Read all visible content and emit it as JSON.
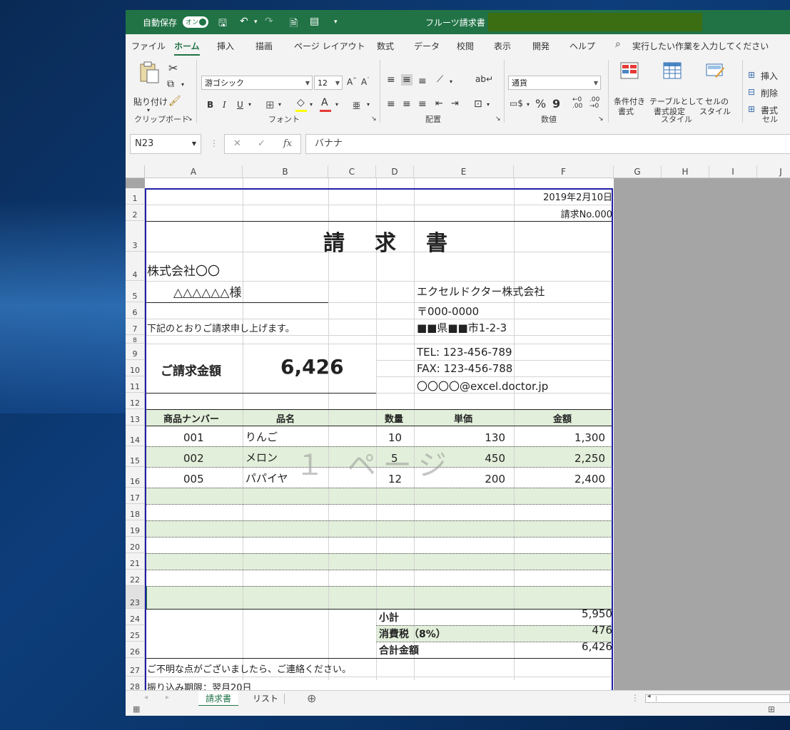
{
  "titlebar": {
    "autosave_label": "自動保存",
    "autosave_state": "オン",
    "title": "フルーツ請求書 -"
  },
  "menu_tabs": [
    "ファイル",
    "ホーム",
    "挿入",
    "描画",
    "ページ レイアウト",
    "数式",
    "データ",
    "校閲",
    "表示",
    "開発",
    "ヘルプ"
  ],
  "search_placeholder": "実行したい作業を入力してください",
  "ribbon": {
    "clipboard": {
      "paste": "貼り付け",
      "group": "クリップボード"
    },
    "font": {
      "name": "游ゴシック",
      "size": "12",
      "group": "フォント",
      "bold": "B",
      "italic": "I",
      "underline": "U"
    },
    "alignment": {
      "group": "配置"
    },
    "number": {
      "format": "通貨",
      "group": "数値",
      "percent": "%",
      "comma": "9"
    },
    "styles": {
      "conditional": "条件付き\n書式",
      "conditional_l1": "条件付き",
      "conditional_l2": "書式",
      "table_l1": "テーブルとして",
      "table_l2": "書式設定",
      "cell_l1": "セルの",
      "cell_l2": "スタイル",
      "group": "スタイル"
    },
    "cells": {
      "insert": "挿入",
      "delete": "削除",
      "format": "書式",
      "group": "セル"
    }
  },
  "formula_bar": {
    "name_box": "N23",
    "cancel": "✕",
    "enter": "✓",
    "fx": "fx",
    "content": "バナナ"
  },
  "columns": [
    "A",
    "B",
    "C",
    "D",
    "E",
    "F",
    "G",
    "H",
    "I",
    "J"
  ],
  "rows": [
    "1",
    "2",
    "3",
    "4",
    "5",
    "6",
    "7",
    "8",
    "9",
    "10",
    "11",
    "12",
    "13",
    "14",
    "15",
    "16",
    "17",
    "18",
    "19",
    "20",
    "21",
    "22",
    "23",
    "24",
    "25",
    "26",
    "27",
    "28"
  ],
  "invoice": {
    "date": "2019年2月10日",
    "invoice_no": "請求No.000",
    "title": "請　求　書",
    "client_company": "株式会社〇〇",
    "client_person": "△△△△△△様",
    "issuer_company": "エクセルドクター株式会社",
    "postal": "〒000-0000",
    "address": "■■県■■市1-2-3",
    "intro": "下記のとおりご請求申し上げます。",
    "amount_label": "ご請求金額",
    "amount_value": "6,426",
    "tel": "TEL: 123-456-789",
    "fax": "FAX: 123-456-788",
    "email": "〇〇〇〇@excel.doctor.jp",
    "headers": {
      "product_no": "商品ナンバー",
      "item": "品名",
      "qty": "数量",
      "unit_price": "単価",
      "amount": "金額"
    },
    "items": [
      {
        "no": "001",
        "name": "りんご",
        "qty": "10",
        "price": "130",
        "amount": "1,300"
      },
      {
        "no": "002",
        "name": "メロン",
        "qty": "5",
        "price": "450",
        "amount": "2,250"
      },
      {
        "no": "005",
        "name": "パパイヤ",
        "qty": "12",
        "price": "200",
        "amount": "2,400"
      }
    ],
    "subtotal_label": "小計",
    "subtotal": "5,950",
    "tax_label": "消費税（8%）",
    "tax": "476",
    "total_label": "合計金額",
    "total": "6,426",
    "note1": "ご不明な点がございましたら、ご連絡ください。",
    "note2": "振り込み期限：翌月20日"
  },
  "watermark": "１ ページ",
  "sheet_tabs": [
    "請求書",
    "リスト"
  ],
  "colors": {
    "excel_green": "#217346",
    "band": "#e2efda",
    "print_border": "#1f1fa8"
  }
}
